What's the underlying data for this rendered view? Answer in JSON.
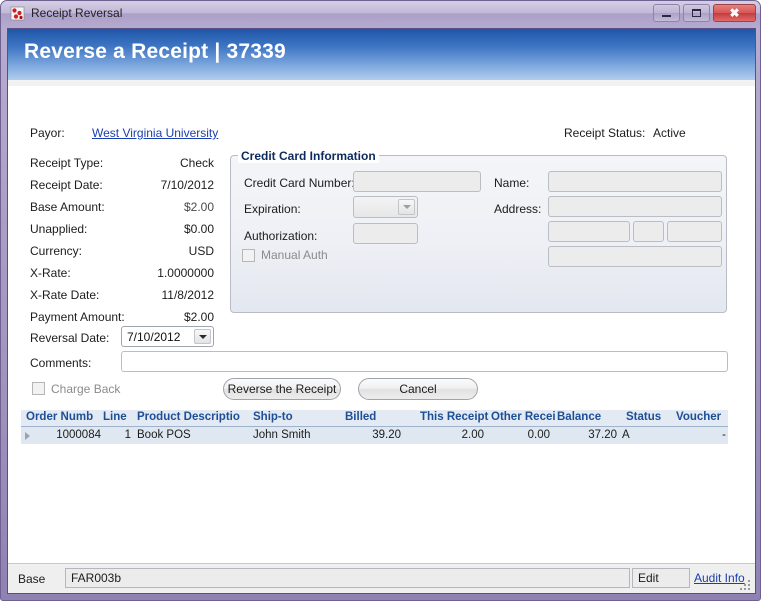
{
  "window": {
    "title": "Receipt Reversal",
    "icon": "app-icon",
    "controls": {
      "minimize": "minimize",
      "maximize": "maximize",
      "close": "close"
    }
  },
  "page_header": {
    "title": "Reverse a Receipt  |  37339",
    "receipt_id": "37339"
  },
  "receipt_status": {
    "label": "Receipt Status:",
    "value": "Active"
  },
  "payor": {
    "label": "Payor:",
    "value": "West Virginia University"
  },
  "details": [
    {
      "label": "Receipt Type:",
      "value": "Check"
    },
    {
      "label": "Receipt Date:",
      "value": "7/10/2012"
    },
    {
      "label": "Base Amount:",
      "value": "$2.00"
    },
    {
      "label": "Unapplied:",
      "value": "$0.00"
    },
    {
      "label": "Currency:",
      "value": "USD"
    },
    {
      "label": "X-Rate:",
      "value": "1.0000000"
    },
    {
      "label": "X-Rate Date:",
      "value": "11/8/2012"
    },
    {
      "label": "Payment Amount:",
      "value": "$2.00"
    }
  ],
  "credit_card": {
    "group_title": "Credit Card Information",
    "card_number_label": "Credit Card Number:",
    "card_number_value": "",
    "expiration_label": "Expiration:",
    "expiration_value": "",
    "authorization_label": "Authorization:",
    "authorization_value": "",
    "manual_auth_label": "Manual Auth",
    "manual_auth_checked": false,
    "name_label": "Name:",
    "name_value": "",
    "address_label": "Address:",
    "address_value": "",
    "city_value": "",
    "state_value": "",
    "zip_value": "",
    "country_value": ""
  },
  "reversal": {
    "date_label": "Reversal Date:",
    "date_value": "7/10/2012",
    "comments_label": "Comments:",
    "comments_value": "",
    "comments_placeholder": "",
    "charge_back_label": "Charge Back",
    "charge_back_checked": false,
    "reverse_button": "Reverse the Receipt",
    "cancel_button": "Cancel"
  },
  "grid": {
    "columns": [
      "Order Numb",
      "Line",
      "Product Descriptio",
      "Ship-to",
      "Billed",
      "This Receipt",
      "Other Recei",
      "Balance",
      "Status",
      "Voucher"
    ],
    "rows": [
      {
        "order_number": "1000084",
        "line": "1",
        "product_description": "Book POS",
        "ship_to": "John Smith",
        "billed": "39.20",
        "this_receipt": "2.00",
        "other_receipts": "0.00",
        "balance": "37.20",
        "status": "A",
        "voucher": "-"
      }
    ]
  },
  "statusbar": {
    "base_label": "Base",
    "base_value": "FAR003b",
    "edit_value": "Edit",
    "audit_link": "Audit Info"
  },
  "colors": {
    "frame": "#a497c0",
    "header_blue_dark": "#1f56a8",
    "header_blue_light": "#b2cdee",
    "link": "#1a3fb0",
    "grid_header_text": "#1d4f96",
    "grid_row_bg": "#dfe7f1",
    "close_red": "#c33a3a"
  }
}
